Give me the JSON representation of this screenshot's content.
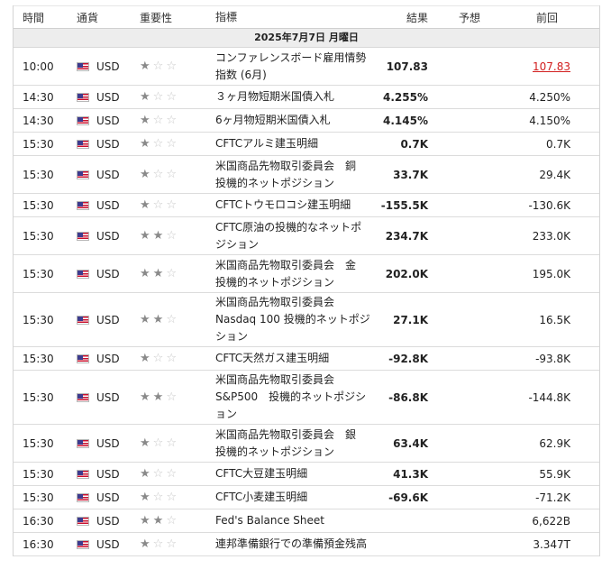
{
  "headers": {
    "time": "時間",
    "currency": "通貨",
    "importance": "重要性",
    "indicator": "指標",
    "actual": "結果",
    "forecast": "予想",
    "previous": "前回"
  },
  "date": "2025年7月7日 月曜日",
  "rows": [
    {
      "time": "10:00",
      "currency": "USD",
      "stars": 1,
      "indicator": "コンファレンスボード雇用情勢指数 (6月)",
      "actual": "107.83",
      "forecast": "",
      "previous": "107.83"
    },
    {
      "time": "14:30",
      "currency": "USD",
      "stars": 1,
      "indicator": "３ヶ月物短期米国債入札",
      "actual": "4.255%",
      "forecast": "",
      "previous": "4.250%"
    },
    {
      "time": "14:30",
      "currency": "USD",
      "stars": 1,
      "indicator": "6ヶ月物短期米国債入札",
      "actual": "4.145%",
      "forecast": "",
      "previous": "4.150%"
    },
    {
      "time": "15:30",
      "currency": "USD",
      "stars": 1,
      "indicator": "CFTCアルミ建玉明細",
      "actual": "0.7K",
      "forecast": "",
      "previous": "0.7K"
    },
    {
      "time": "15:30",
      "currency": "USD",
      "stars": 1,
      "indicator": "米国商品先物取引委員会　銅　投機的ネットポジション",
      "actual": "33.7K",
      "forecast": "",
      "previous": "29.4K"
    },
    {
      "time": "15:30",
      "currency": "USD",
      "stars": 1,
      "indicator": "CFTCトウモロコシ建玉明細",
      "actual": "-155.5K",
      "forecast": "",
      "previous": "-130.6K"
    },
    {
      "time": "15:30",
      "currency": "USD",
      "stars": 2,
      "indicator": "CFTC原油の投機的なネットポジション",
      "actual": "234.7K",
      "forecast": "",
      "previous": "233.0K"
    },
    {
      "time": "15:30",
      "currency": "USD",
      "stars": 2,
      "indicator": "米国商品先物取引委員会　金　投機的ネットポジション",
      "actual": "202.0K",
      "forecast": "",
      "previous": "195.0K"
    },
    {
      "time": "15:30",
      "currency": "USD",
      "stars": 2,
      "indicator": "米国商品先物取引委員会 Nasdaq 100 投機的ネットポジション",
      "actual": "27.1K",
      "forecast": "",
      "previous": "16.5K"
    },
    {
      "time": "15:30",
      "currency": "USD",
      "stars": 1,
      "indicator": "CFTC天然ガス建玉明細",
      "actual": "-92.8K",
      "forecast": "",
      "previous": "-93.8K"
    },
    {
      "time": "15:30",
      "currency": "USD",
      "stars": 2,
      "indicator": "米国商品先物取引委員会 S&P500　投機的ネットポジション",
      "actual": "-86.8K",
      "forecast": "",
      "previous": "-144.8K"
    },
    {
      "time": "15:30",
      "currency": "USD",
      "stars": 1,
      "indicator": "米国商品先物取引委員会　銀　投機的ネットポジション",
      "actual": "63.4K",
      "forecast": "",
      "previous": "62.9K"
    },
    {
      "time": "15:30",
      "currency": "USD",
      "stars": 1,
      "indicator": "CFTC大豆建玉明細",
      "actual": "41.3K",
      "forecast": "",
      "previous": "55.9K"
    },
    {
      "time": "15:30",
      "currency": "USD",
      "stars": 1,
      "indicator": "CFTC小麦建玉明細",
      "actual": "-69.6K",
      "forecast": "",
      "previous": "-71.2K"
    },
    {
      "time": "16:30",
      "currency": "USD",
      "stars": 2,
      "indicator": "Fed's Balance Sheet",
      "actual": "",
      "forecast": "",
      "previous": "6,622B"
    },
    {
      "time": "16:30",
      "currency": "USD",
      "stars": 1,
      "indicator": "連邦準備銀行での準備預金残高",
      "actual": "",
      "forecast": "",
      "previous": "3.347T"
    }
  ],
  "colors": {
    "previous_revised": "#d21e1e",
    "star_on": "#8a8a8a",
    "star_off": "#c8c8c8",
    "date_bar": "#ededed"
  }
}
